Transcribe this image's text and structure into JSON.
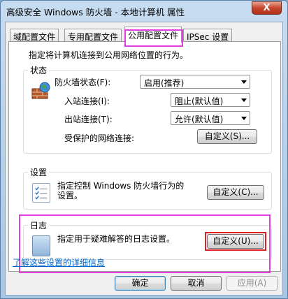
{
  "window": {
    "title": "高级安全 Windows 防火墙 - 本地计算机 属性",
    "close_glyph": "X"
  },
  "tabs": [
    {
      "label": "域配置文件"
    },
    {
      "label": "专用配置文件"
    },
    {
      "label": "公用配置文件"
    },
    {
      "label": "IPSec 设置"
    }
  ],
  "panel": {
    "description": "指定将计算机连接到公用网络位置的行为。",
    "state_group": {
      "label": "状态",
      "firewall_state_label": "防火墙状态(F):",
      "firewall_state_value": "启用(推荐)",
      "inbound_label": "入站连接(I):",
      "inbound_value": "阻止(默认值)",
      "outbound_label": "出站连接(T):",
      "outbound_value": "允许(默认值)",
      "protected_label": "受保护的网络连接:",
      "protected_button": "自定义(S)..."
    },
    "settings_group": {
      "label": "设置",
      "text_line1": "指定控制 Windows 防火墙行为的",
      "text_line2": "设置。",
      "button": "自定义(C)..."
    },
    "log_group": {
      "label": "日志",
      "text": "指定用于疑难解答的日志设置。",
      "button": "自定义(U)..."
    },
    "link": "了解这些设置的详细信息"
  },
  "footer": {
    "ok": "确定",
    "cancel": "取消",
    "apply": "应用(A)"
  },
  "colors": {
    "highlight_pink": "#e040e0",
    "highlight_red": "#e02020",
    "link": "#0066cc"
  }
}
